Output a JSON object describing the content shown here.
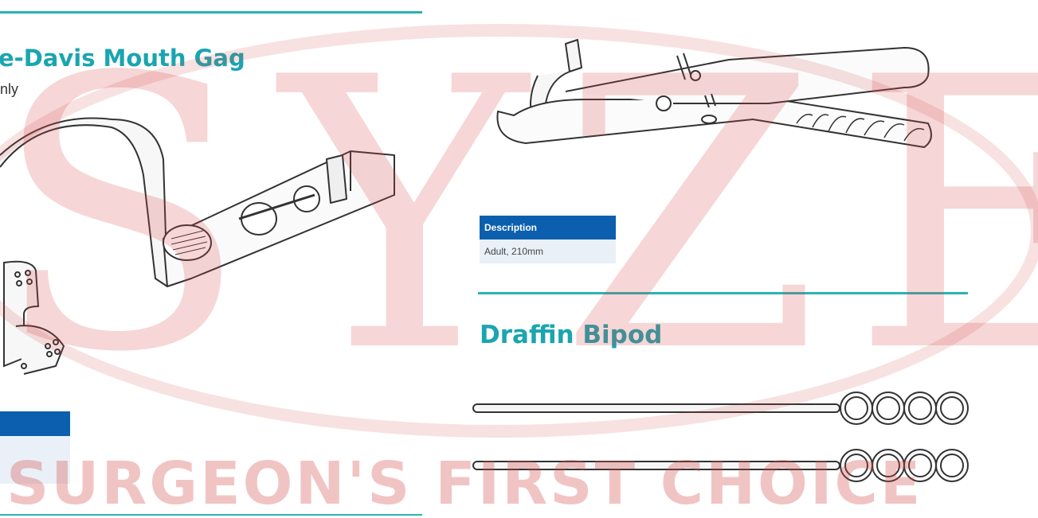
{
  "left_product": {
    "title": "e-Davis Mouth Gag",
    "subtitle": "nly"
  },
  "right_product_1": {
    "description_header": "Description",
    "description_value": "Adult, 210mm"
  },
  "right_product_2": {
    "title": "Draffin Bipod"
  },
  "watermark": {
    "letters": "SYZE",
    "tagline": "SURGEON'S FIRST CHOICE",
    "color": "#d44646"
  },
  "colors": {
    "accent_rule": "#2bb3b1",
    "title": "#1aa5b0",
    "table_header": "#0b5fae",
    "table_row": "#eaf0f7"
  }
}
